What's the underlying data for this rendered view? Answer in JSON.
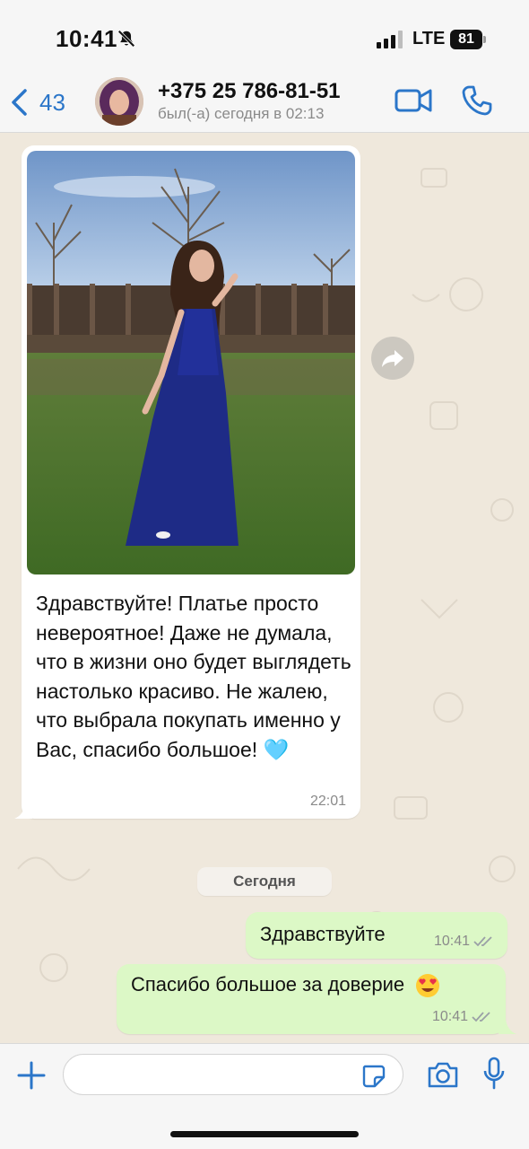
{
  "status_bar": {
    "time": "10:41",
    "network": "LTE",
    "battery": "81",
    "icons": [
      "bell-slash-icon",
      "signal-bars-icon",
      "battery-icon"
    ]
  },
  "header": {
    "back_count": "43",
    "contact_name": "+375 25 786-81-51",
    "last_seen": "был(-а) сегодня в 02:13",
    "icons": [
      "chevron-left-icon",
      "video-call-icon",
      "phone-icon"
    ]
  },
  "messages": {
    "incoming": {
      "text": "Здравствуйте! Платье просто невероятное! Даже не думала, что в жизни оно будет выглядеть настолько красиво. Не жалею, что выбрала покупать именно у Вас, спасибо большое! 🩵",
      "time": "22:01",
      "has_photo": true
    },
    "date_separator": "Сегодня",
    "outgoing": [
      {
        "text": "Здравствуйте",
        "time": "10:41",
        "status": "read"
      },
      {
        "text": "Спасибо большое за доверие",
        "emoji": "😍",
        "time": "10:41",
        "status": "read"
      }
    ]
  },
  "composer": {
    "placeholder": "",
    "icons": [
      "plus-icon",
      "sticker-icon",
      "camera-icon",
      "microphone-icon"
    ]
  },
  "colors": {
    "accent": "#2b76c9",
    "outgoing_bubble": "#dcf8c6",
    "incoming_bubble": "#ffffff",
    "chat_background": "#efe8dc"
  }
}
